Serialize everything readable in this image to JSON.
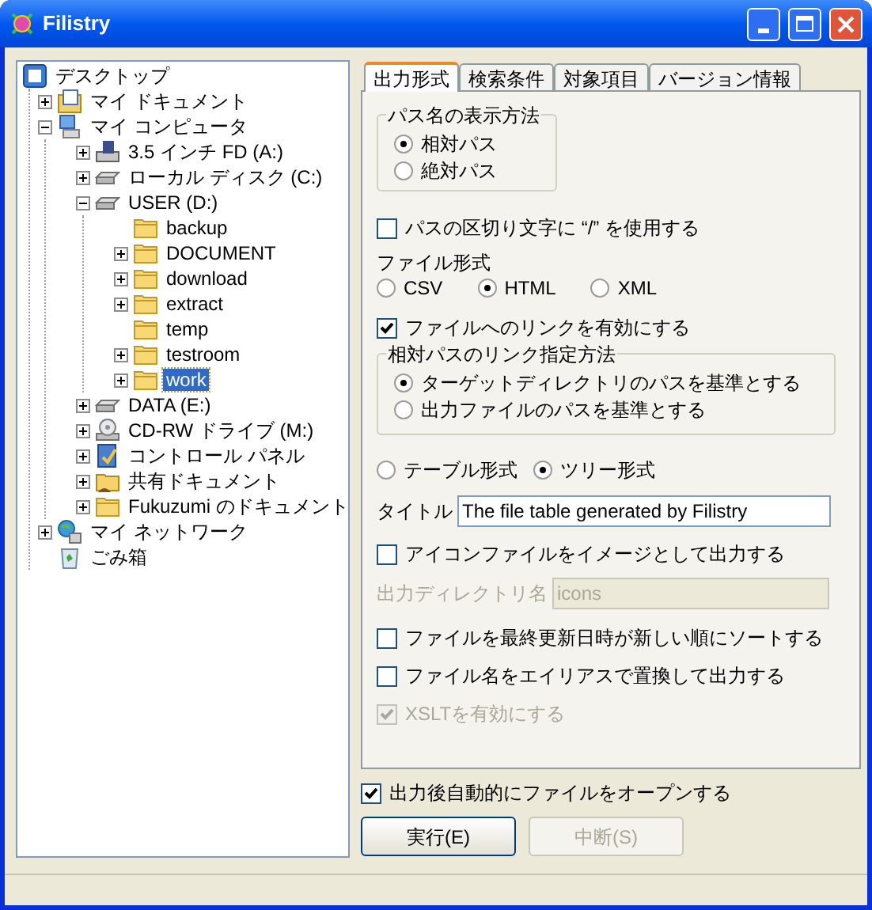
{
  "window": {
    "title": "Filistry"
  },
  "tree": [
    {
      "label": "デスクトップ",
      "kind": "desktop",
      "selected": false,
      "children": [
        {
          "label": "マイ ドキュメント",
          "kind": "documents",
          "expanded": false,
          "selected": false
        },
        {
          "label": "マイ コンピュータ",
          "kind": "computer",
          "expanded": true,
          "selected": false,
          "children": [
            {
              "label": "3.5 インチ FD (A:)",
              "kind": "floppy",
              "expanded": false,
              "selected": false
            },
            {
              "label": "ローカル ディスク (C:)",
              "kind": "drive",
              "expanded": false,
              "selected": false
            },
            {
              "label": "USER (D:)",
              "kind": "drive",
              "expanded": true,
              "selected": false,
              "children": [
                {
                  "label": "backup",
                  "kind": "folder",
                  "selected": false
                },
                {
                  "label": "DOCUMENT",
                  "kind": "folder",
                  "expanded": false,
                  "selected": false
                },
                {
                  "label": "download",
                  "kind": "folder",
                  "expanded": false,
                  "selected": false
                },
                {
                  "label": "extract",
                  "kind": "folder",
                  "expanded": false,
                  "selected": false
                },
                {
                  "label": "temp",
                  "kind": "folder",
                  "selected": false
                },
                {
                  "label": "testroom",
                  "kind": "folder",
                  "expanded": false,
                  "selected": false
                },
                {
                  "label": "work",
                  "kind": "folder",
                  "expanded": false,
                  "selected": true
                }
              ]
            },
            {
              "label": "DATA (E:)",
              "kind": "drive",
              "expanded": false,
              "selected": false
            },
            {
              "label": "CD-RW ドライブ (M:)",
              "kind": "cdrom",
              "expanded": false,
              "selected": false
            },
            {
              "label": "コントロール パネル",
              "kind": "control-panel",
              "expanded": false,
              "selected": false
            },
            {
              "label": "共有ドキュメント",
              "kind": "shared-folder",
              "expanded": false,
              "selected": false
            },
            {
              "label": "Fukuzumi のドキュメント",
              "kind": "folder",
              "expanded": false,
              "selected": false
            }
          ]
        },
        {
          "label": "マイ ネットワーク",
          "kind": "network",
          "expanded": false,
          "selected": false
        },
        {
          "label": "ごみ箱",
          "kind": "trash",
          "selected": false
        }
      ]
    }
  ],
  "tabs": [
    {
      "label": "出力形式",
      "selected": true
    },
    {
      "label": "検索条件",
      "selected": false
    },
    {
      "label": "対象項目",
      "selected": false
    },
    {
      "label": "バージョン情報",
      "selected": false
    }
  ],
  "path_display": {
    "title": "パス名の表示方法",
    "options": [
      {
        "label": "相対パス",
        "selected": true
      },
      {
        "label": "絶対パス",
        "selected": false
      }
    ]
  },
  "slash_separator": {
    "label": "パスの区切り文字に “/” を使用する",
    "checked": false,
    "disabled": false
  },
  "file_format": {
    "label": "ファイル形式",
    "options": [
      {
        "label": "CSV",
        "selected": false
      },
      {
        "label": "HTML",
        "selected": true
      },
      {
        "label": "XML",
        "selected": false
      }
    ]
  },
  "enable_links": {
    "label": "ファイルへのリンクを有効にする",
    "checked": true,
    "disabled": false
  },
  "link_mode": {
    "title": "相対パスのリンク指定方法",
    "options": [
      {
        "label": "ターゲットディレクトリのパスを基準とする",
        "selected": true
      },
      {
        "label": "出力ファイルのパスを基準とする",
        "selected": false
      }
    ]
  },
  "layout": {
    "options": [
      {
        "label": "テーブル形式",
        "selected": false
      },
      {
        "label": "ツリー形式",
        "selected": true
      }
    ]
  },
  "title_field": {
    "label": "タイトル",
    "value": "The file table generated by Filistry",
    "disabled": false
  },
  "icon_images": {
    "label": "アイコンファイルをイメージとして出力する",
    "checked": false,
    "disabled": false
  },
  "output_dir": {
    "label": "出力ディレクトリ名",
    "value": "icons",
    "disabled": true
  },
  "sort_by_date": {
    "label": "ファイルを最終更新日時が新しい順にソートする",
    "checked": false,
    "disabled": false
  },
  "alias_names": {
    "label": "ファイル名をエイリアスで置換して出力する",
    "checked": false,
    "disabled": false
  },
  "xslt": {
    "label": "XSLTを有効にする",
    "checked": true,
    "disabled": true
  },
  "auto_open": {
    "label": "出力後自動的にファイルをオープンする",
    "checked": true,
    "disabled": false
  },
  "buttons": [
    {
      "label": "実行(E)",
      "disabled": false
    },
    {
      "label": "中断(S)",
      "disabled": true
    }
  ]
}
